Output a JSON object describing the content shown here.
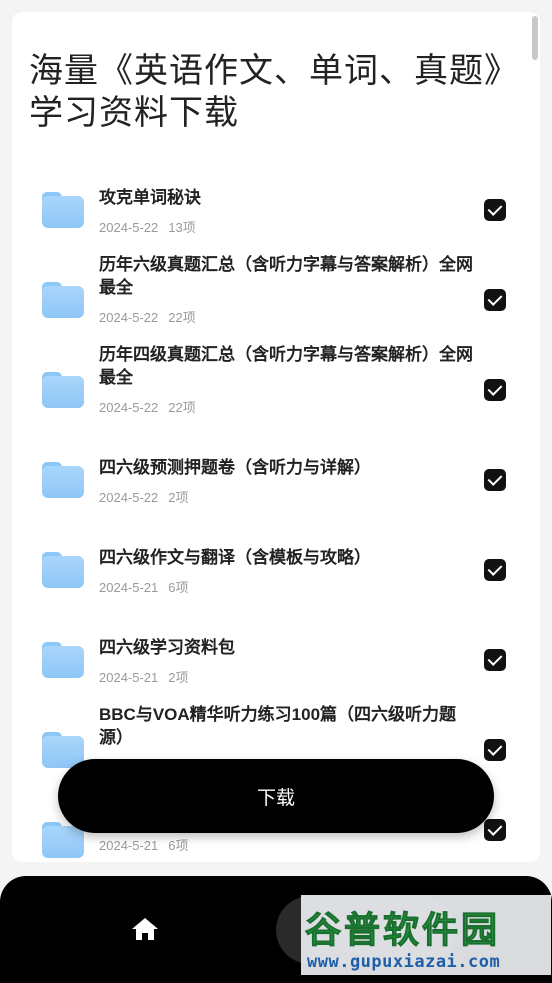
{
  "page": {
    "title": "海量《英语作文、单词、真题》学习资料下载"
  },
  "files": [
    {
      "name": "攻克单词秘诀",
      "date": "2024-5-22",
      "count": "13项",
      "checked": true
    },
    {
      "name": "历年六级真题汇总（含听力字幕与答案解析）全网最全",
      "date": "2024-5-22",
      "count": "22项",
      "checked": true
    },
    {
      "name": "历年四级真题汇总（含听力字幕与答案解析）全网最全",
      "date": "2024-5-22",
      "count": "22项",
      "checked": true
    },
    {
      "name": "四六级预测押题卷（含听力与详解）",
      "date": "2024-5-22",
      "count": "2项",
      "checked": true
    },
    {
      "name": "四六级作文与翻译（含模板与攻略）",
      "date": "2024-5-21",
      "count": "6项",
      "checked": true
    },
    {
      "name": "四六级学习资料包",
      "date": "2024-5-21",
      "count": "2项",
      "checked": true
    },
    {
      "name": "BBC与VOA精华听力练习100篇（四六级听力题源）",
      "date": "",
      "count": "",
      "checked": true
    },
    {
      "name": "",
      "date": "2024-5-21",
      "count": "6项",
      "checked": true
    }
  ],
  "actions": {
    "download_label": "下载"
  },
  "bottom_nav": {
    "home_icon": "home-icon"
  },
  "watermark": {
    "logo_text": "谷普软件园",
    "url": "www.gupuxiazai.com"
  },
  "colors": {
    "folder": "#9ccff8",
    "accent": "#000000",
    "meta_text": "#9a9a9a",
    "watermark_green": "#2aa84a",
    "watermark_blue": "#1f5fa8"
  }
}
